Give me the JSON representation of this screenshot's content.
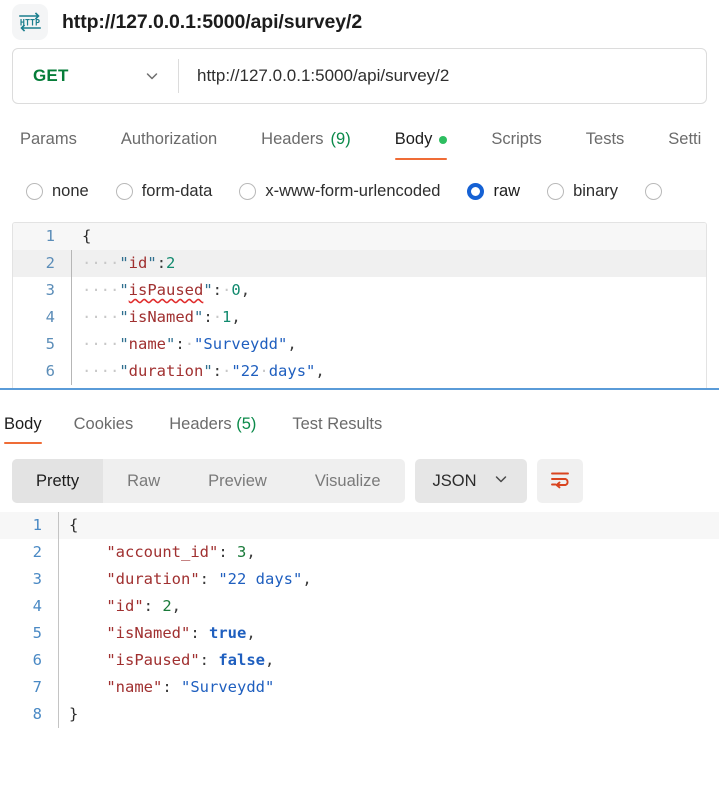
{
  "window": {
    "icon_label": "HTTP",
    "title": "http://127.0.0.1:5000/api/survey/2"
  },
  "request_bar": {
    "method": "GET",
    "url": "http://127.0.0.1:5000/api/survey/2"
  },
  "request_tabs": [
    {
      "label": "Params",
      "active": false
    },
    {
      "label": "Authorization",
      "active": false
    },
    {
      "label": "Headers",
      "count": "(9)",
      "active": false
    },
    {
      "label": "Body",
      "active": true,
      "dot": true
    },
    {
      "label": "Scripts",
      "active": false
    },
    {
      "label": "Tests",
      "active": false
    },
    {
      "label": "Setti",
      "active": false
    }
  ],
  "body_types": [
    {
      "label": "none",
      "checked": false
    },
    {
      "label": "form-data",
      "checked": false
    },
    {
      "label": "x-www-form-urlencoded",
      "checked": false
    },
    {
      "label": "raw",
      "checked": true
    },
    {
      "label": "binary",
      "checked": false
    },
    {
      "label": "",
      "checked": false
    }
  ],
  "request_body": {
    "lines": [
      {
        "no": "1",
        "text": "{"
      },
      {
        "no": "2",
        "text": "    \"id\":2"
      },
      {
        "no": "3",
        "text": "    \"isPaused\": 0,"
      },
      {
        "no": "4",
        "text": "    \"isNamed\": 1,"
      },
      {
        "no": "5",
        "text": "    \"name\": \"Surveydd\","
      },
      {
        "no": "6",
        "text": "    \"duration\": \"22 days\","
      }
    ]
  },
  "response_tabs": [
    {
      "label": "Body",
      "active": true
    },
    {
      "label": "Cookies",
      "active": false
    },
    {
      "label": "Headers",
      "count": "(5)",
      "active": false
    },
    {
      "label": "Test Results",
      "active": false
    }
  ],
  "response_toolbar": {
    "segments": [
      {
        "label": "Pretty",
        "active": true
      },
      {
        "label": "Raw",
        "active": false
      },
      {
        "label": "Preview",
        "active": false
      },
      {
        "label": "Visualize",
        "active": false
      }
    ],
    "format": "JSON",
    "wrap_icon": "word-wrap-icon"
  },
  "response_body": {
    "lines": [
      {
        "no": "1",
        "text": "{"
      },
      {
        "no": "2",
        "text": "    \"account_id\": 3,"
      },
      {
        "no": "3",
        "text": "    \"duration\": \"22 days\","
      },
      {
        "no": "4",
        "text": "    \"id\": 2,"
      },
      {
        "no": "5",
        "text": "    \"isNamed\": true,"
      },
      {
        "no": "6",
        "text": "    \"isPaused\": false,"
      },
      {
        "no": "7",
        "text": "    \"name\": \"Surveydd\""
      },
      {
        "no": "8",
        "text": "}"
      }
    ],
    "json": {
      "account_id": 3,
      "duration": "22 days",
      "id": 2,
      "isNamed": true,
      "isPaused": false,
      "name": "Surveydd"
    }
  },
  "colors": {
    "accent_orange": "#ef6c36",
    "method_green": "#067d39",
    "radio_blue": "#1561d4",
    "splitter_blue": "#5a9bd8",
    "dot_green": "#2dbe60",
    "count_green": "#0b8a4a"
  }
}
